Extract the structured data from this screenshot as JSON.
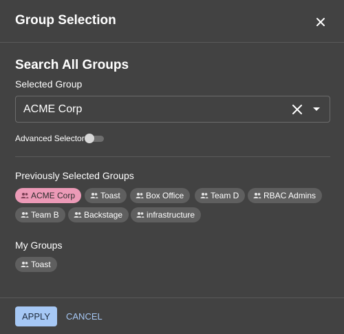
{
  "dialog": {
    "title": "Group Selection"
  },
  "search": {
    "heading": "Search All Groups",
    "label": "Selected Group",
    "value": "ACME Corp"
  },
  "advanced": {
    "label": "Advanced Selector",
    "enabled": false
  },
  "previous": {
    "label": "Previously Selected Groups",
    "chips": [
      "ACME Corp",
      "Toast",
      "Box Office",
      "Team D",
      "RBAC Admins",
      "Team B",
      "Backstage",
      "infrastructure"
    ]
  },
  "mine": {
    "label": "My Groups",
    "chips": [
      "Toast"
    ]
  },
  "actions": {
    "apply": "APPLY",
    "cancel": "CANCEL"
  },
  "colors": {
    "background": "#424242",
    "active_chip": "#ec9ab7",
    "chip": "#5f5f5f",
    "primary": "#a6c8f5"
  },
  "icons": {
    "chip_icon": "group-icon",
    "close": "close-icon",
    "clear": "clear-icon",
    "dropdown": "chevron-down-icon"
  }
}
